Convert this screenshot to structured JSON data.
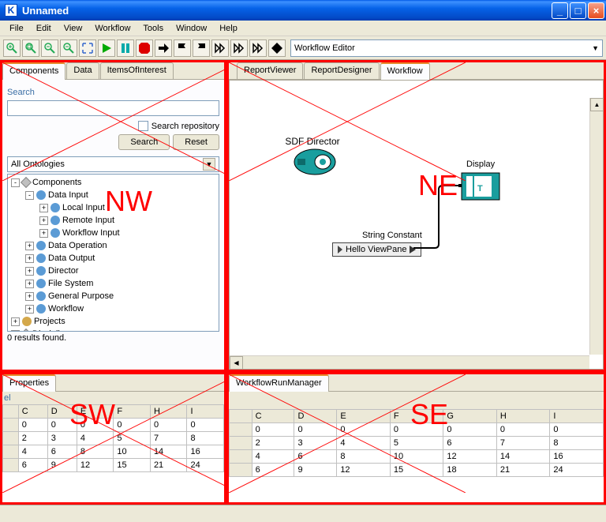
{
  "window": {
    "title": "Unnamed",
    "app_letter": "K"
  },
  "menu": [
    "File",
    "Edit",
    "View",
    "Workflow",
    "Tools",
    "Window",
    "Help"
  ],
  "toolbar_select": "Workflow Editor",
  "nw": {
    "tabs": [
      "Components",
      "Data",
      "ItemsOfInterest"
    ],
    "search_label": "Search",
    "search_value": "",
    "repo_label": "Search repository",
    "search_btn": "Search",
    "reset_btn": "Reset",
    "ontology_select": "All Ontologies",
    "results": "0 results found.",
    "tree": [
      {
        "d": 0,
        "exp": "-",
        "ico": "pkg",
        "label": "Components"
      },
      {
        "d": 1,
        "exp": "-",
        "ico": "blue",
        "label": "Data Input"
      },
      {
        "d": 2,
        "exp": "+",
        "ico": "blue",
        "label": "Local Input"
      },
      {
        "d": 2,
        "exp": "+",
        "ico": "blue",
        "label": "Remote Input"
      },
      {
        "d": 2,
        "exp": "+",
        "ico": "blue",
        "label": "Workflow Input"
      },
      {
        "d": 1,
        "exp": "+",
        "ico": "blue",
        "label": "Data Operation"
      },
      {
        "d": 1,
        "exp": "+",
        "ico": "blue",
        "label": "Data Output"
      },
      {
        "d": 1,
        "exp": "+",
        "ico": "blue",
        "label": "Director"
      },
      {
        "d": 1,
        "exp": "+",
        "ico": "blue",
        "label": "File System"
      },
      {
        "d": 1,
        "exp": "+",
        "ico": "blue",
        "label": "General Purpose"
      },
      {
        "d": 1,
        "exp": "+",
        "ico": "blue",
        "label": "Workflow"
      },
      {
        "d": 0,
        "exp": "+",
        "ico": "pin",
        "label": "Projects"
      },
      {
        "d": 0,
        "exp": "+",
        "ico": "pkg",
        "label": "Disciplines"
      }
    ]
  },
  "ne": {
    "tabs": [
      "ReportViewer",
      "ReportDesigner",
      "Workflow"
    ],
    "sdf": "SDF Director",
    "display": "Display",
    "string_constant": "String Constant",
    "hello": "Hello ViewPane"
  },
  "sw": {
    "tab": "Properties",
    "el": "el",
    "headers": [
      "C",
      "D",
      "E",
      "F",
      "H",
      "I"
    ],
    "rows": [
      [
        "0",
        "0",
        "0",
        "0",
        "0",
        "0"
      ],
      [
        "2",
        "3",
        "4",
        "5",
        "7",
        "8"
      ],
      [
        "4",
        "6",
        "8",
        "10",
        "14",
        "16"
      ],
      [
        "6",
        "9",
        "12",
        "15",
        "21",
        "24"
      ]
    ]
  },
  "se": {
    "tab": "WorkflowRunManager",
    "headers": [
      "C",
      "D",
      "E",
      "F",
      "G",
      "H",
      "I"
    ],
    "rows": [
      [
        "0",
        "0",
        "0",
        "0",
        "0",
        "0",
        "0"
      ],
      [
        "2",
        "3",
        "4",
        "5",
        "6",
        "7",
        "8"
      ],
      [
        "4",
        "6",
        "8",
        "10",
        "12",
        "14",
        "16"
      ],
      [
        "6",
        "9",
        "12",
        "15",
        "18",
        "21",
        "24"
      ]
    ]
  },
  "quads": {
    "nw": "NW",
    "ne": "NE",
    "sw": "SW",
    "se": "SE"
  }
}
